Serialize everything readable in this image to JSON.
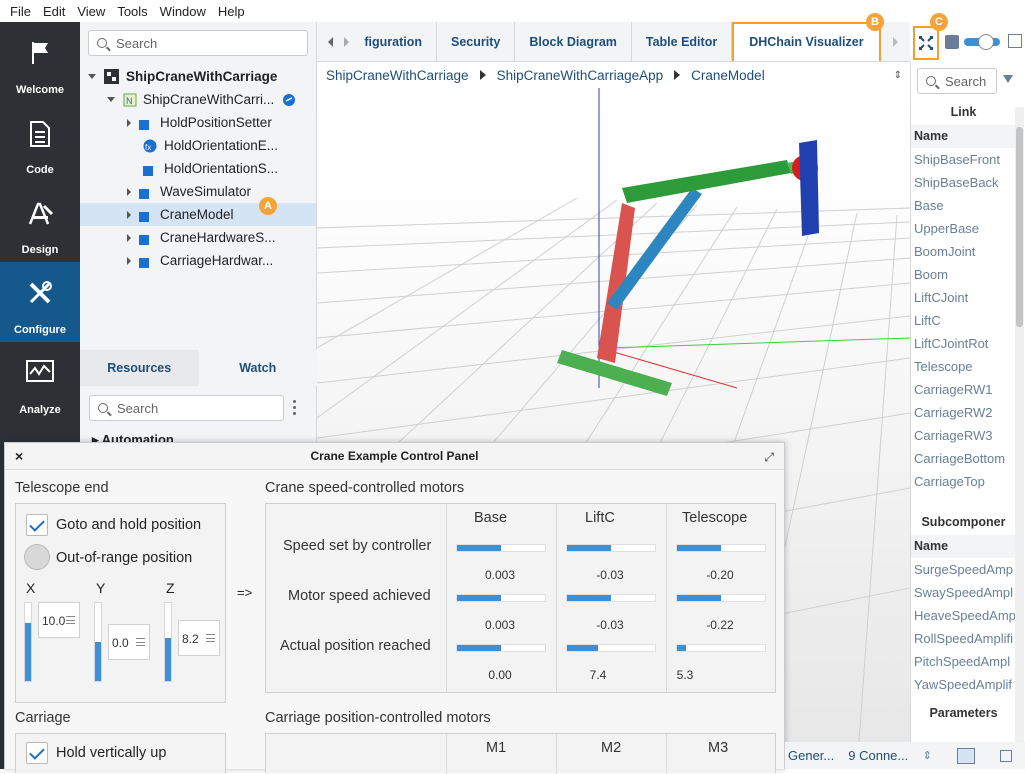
{
  "menu": {
    "file": "File",
    "edit": "Edit",
    "view": "View",
    "tools": "Tools",
    "window": "Window",
    "help": "Help"
  },
  "nav": [
    {
      "label": "Welcome",
      "icon": "flag-icon"
    },
    {
      "label": "Code",
      "icon": "document-icon"
    },
    {
      "label": "Design",
      "icon": "design-icon"
    },
    {
      "label": "Configure",
      "icon": "tools-icon"
    },
    {
      "label": "Analyze",
      "icon": "chart-icon"
    }
  ],
  "explorer": {
    "search_placeholder": "Search",
    "root": "ShipCraneWithCarriage",
    "app": "ShipCraneWithCarri...",
    "items": [
      "HoldPositionSetter",
      "HoldOrientationE...",
      "HoldOrientationS...",
      "WaveSimulator",
      "CraneModel",
      "CraneHardwareS...",
      "CarriageHardwar..."
    ],
    "tabs": {
      "resources": "Resources",
      "watch": "Watch"
    },
    "search2_placeholder": "Search",
    "automation": "Automation"
  },
  "tabs": [
    "figuration",
    "Security",
    "Block Diagram",
    "Table Editor",
    "DHChain Visualizer"
  ],
  "breadcrumb": [
    "ShipCraneWithCarriage",
    "ShipCraneWithCarriageApp",
    "CraneModel"
  ],
  "right_panel": {
    "search_placeholder": "Search",
    "link_header": "Link",
    "name_header": "Name",
    "links": [
      "ShipBaseFront",
      "ShipBaseBack",
      "Base",
      "UpperBase",
      "BoomJoint",
      "Boom",
      "LiftCJoint",
      "LiftC",
      "LiftCJointRot",
      "Telescope",
      "CarriageRW1",
      "CarriageRW2",
      "CarriageRW3",
      "CarriageBottom",
      "CarriageTop"
    ],
    "subcomp_header": "Subcomponer",
    "name_header2": "Name",
    "subcomps": [
      "SurgeSpeedAmp",
      "SwaySpeedAmpl",
      "HeaveSpeedAmp",
      "RollSpeedAmplifi",
      "PitchSpeedAmpl",
      "YawSpeedAmplif"
    ],
    "params_header": "Parameters"
  },
  "markers": {
    "a": "A",
    "b": "B",
    "c": "C"
  },
  "control_panel": {
    "title": "Crane Example Control Panel",
    "close": "×",
    "telescope_end": "Telescope end",
    "goto_hold": "Goto and hold position",
    "out_of_range": "Out-of-range position",
    "axes": [
      {
        "label": "X",
        "value": "10.0",
        "level": 0.75
      },
      {
        "label": "Y",
        "value": "0.0",
        "level": 0.5
      },
      {
        "label": "Z",
        "value": "8.2",
        "level": 0.55
      }
    ],
    "arrow": "=>",
    "speed_title": "Crane speed-controlled motors",
    "columns": [
      "Base",
      "LiftC",
      "Telescope"
    ],
    "rows": [
      {
        "label": "Speed set by controller",
        "values": [
          "0.003",
          "-0.03",
          "-0.20"
        ],
        "levels": [
          0.5,
          0.5,
          0.5
        ]
      },
      {
        "label": "Motor speed achieved",
        "values": [
          "0.003",
          "-0.03",
          "-0.22"
        ],
        "levels": [
          0.5,
          0.5,
          0.5
        ]
      },
      {
        "label": "Actual position reached",
        "values": [
          "0.00",
          "7.4",
          "5.3"
        ],
        "levels": [
          0.5,
          0.35,
          0.1
        ]
      }
    ],
    "carriage": "Carriage",
    "hold_vertically": "Hold vertically up",
    "carriage_title": "Carriage position-controlled motors",
    "carriage_columns": [
      "M1",
      "M2",
      "M3"
    ]
  },
  "status": {
    "gen": "Gener...",
    "conn": "9  Conne..."
  }
}
